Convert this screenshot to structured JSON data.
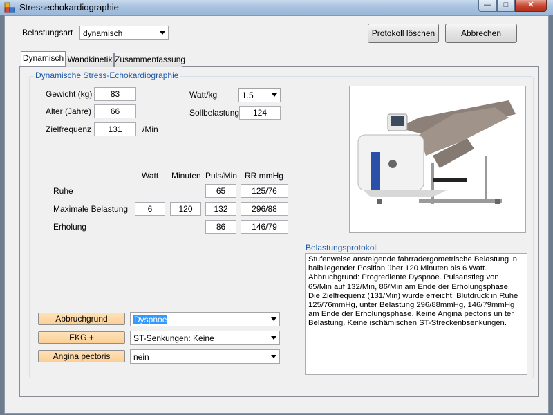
{
  "window": {
    "title": "Stressechokardiographie"
  },
  "header": {
    "belastungsart_label": "Belastungsart",
    "belastungsart_value": "dynamisch",
    "protokoll_loeschen": "Protokoll löschen",
    "abbrechen": "Abbrechen"
  },
  "tabs": [
    {
      "label": "Dynamisch",
      "active": true
    },
    {
      "label": "Wandkinetik",
      "active": false
    },
    {
      "label": "Zusammenfassung",
      "active": false
    }
  ],
  "group": {
    "title": "Dynamische Stress-Echokardiographie"
  },
  "params": {
    "gewicht_label": "Gewicht (kg)",
    "gewicht": "83",
    "alter_label": "Alter (Jahre)",
    "alter": "66",
    "zielfrequenz_label": "Zielfrequenz",
    "zielfrequenz": "131",
    "zielfrequenz_unit": "/Min",
    "wattkg_label": "Watt/kg",
    "wattkg": "1.5",
    "sollbelastung_label": "Sollbelastung",
    "sollbelastung": "124"
  },
  "table": {
    "headers": {
      "watt": "Watt",
      "minuten": "Minuten",
      "puls": "Puls/Min",
      "rr": "RR mmHg"
    },
    "rows": [
      {
        "label": "Ruhe",
        "watt": "",
        "minuten": "",
        "puls": "65",
        "rr": "125/76"
      },
      {
        "label": "Maximale Belastung",
        "watt": "6",
        "minuten": "120",
        "puls": "132",
        "rr": "296/88"
      },
      {
        "label": "Erholung",
        "watt": "",
        "minuten": "",
        "puls": "86",
        "rr": "146/79"
      }
    ]
  },
  "protokoll": {
    "label": "Belastungsprotokoll",
    "text": "Stufenweise ansteigende fahrradergometrische Belastung in halbliegender Position über 120 Minuten bis 6 Watt. Abbruchgrund: Progrediente Dyspnoe. Pulsanstieg von 65/Min auf 132/Min, 86/Min am Ende der Erholungsphase. Die Zielfrequenz (131/Min) wurde erreicht. Blutdruck in Ruhe 125/76mmHg, unter Belastung 296/88mmHg, 146/79mmHg am Ende der Erholungsphase. Keine Angina pectoris un ter Belastung. Keine ischämischen ST-Streckenbsenkungen."
  },
  "bottom": {
    "abbruchgrund_label": "Abbruchgrund",
    "abbruchgrund_value": "Dyspnoe",
    "ekg_label": "EKG  +",
    "ekg_value": "ST-Senkungen: Keine",
    "angina_label": "Angina pectoris",
    "angina_value": "nein"
  },
  "icons": {
    "app": "app-icon",
    "minimize": "minimize-icon",
    "maximize": "maximize-icon",
    "close": "close-icon",
    "dropdown": "chevron-down-icon"
  },
  "colors": {
    "group_title": "#1e5ba9",
    "peach_button": "#fbcf96",
    "selection": "#3399ff",
    "close_button": "#c7432d"
  }
}
